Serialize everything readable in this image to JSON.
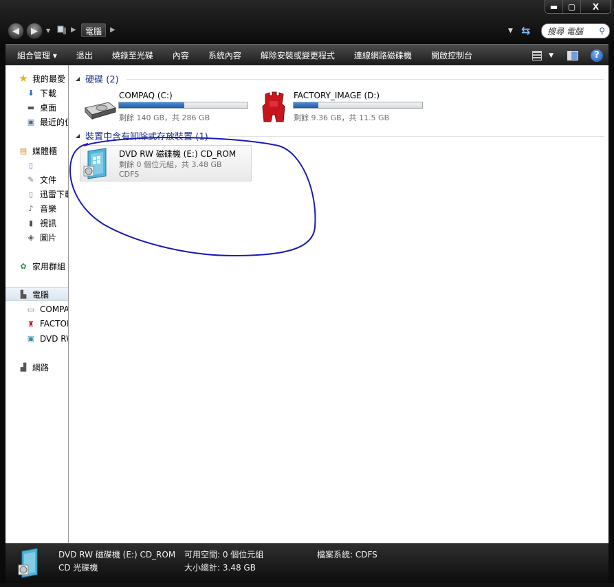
{
  "window": {
    "minimize": "▬",
    "maximize": "▢",
    "close": "X"
  },
  "address": {
    "crumb": "電腦"
  },
  "search": {
    "placeholder": "搜尋 電腦"
  },
  "toolbar": {
    "items": [
      "組合管理 ▾",
      "退出",
      "燒錄至光碟",
      "內容",
      "系統內容",
      "解除安裝或變更程式",
      "連線網路磁碟機",
      "開啟控制台"
    ]
  },
  "nav": {
    "favorites": "我的最愛",
    "downloads": "下載",
    "desktop": "桌面",
    "recent": "最近的位置",
    "libraries": "媒體櫃",
    "docs": "文件",
    "thunder": "迅雷下載",
    "music": "音樂",
    "video": "視訊",
    "pictures": "圖片",
    "homegroup": "家用群組",
    "computer": "電腦",
    "compaq": "COMPAQ (C:)",
    "factory": "FACTORY_IMAGE (D:)",
    "dvd": "DVD RW 磁碟機 (E:) CD_ROM",
    "network": "網路"
  },
  "groups": {
    "hdd": "硬碟 (2)",
    "removable": "裝置中含有卸除式存放裝置 (1)"
  },
  "drives": {
    "c": {
      "name": "COMPAQ (C:)",
      "free": "剩餘 140 GB，共 286 GB",
      "used_fraction": 0.51
    },
    "d": {
      "name": "FACTORY_IMAGE (D:)",
      "free": "剩餘 9.36 GB，共 11.5 GB",
      "used_fraction": 0.19
    },
    "e": {
      "name": "DVD RW 磁碟機 (E:) CD_ROM",
      "free": "剩餘 0 個位元組，共 3.48 GB",
      "fs": "CDFS"
    }
  },
  "status": {
    "name": "DVD RW 磁碟機 (E:) CD_ROM",
    "type": "CD 光碟機",
    "free_label": "可用空間: 0 個位元組",
    "total_label": "大小總計: 3.48 GB",
    "fs_label": "檔案系統: CDFS"
  },
  "colors": {
    "annotation": "#1a1ab8",
    "accent": "#1e3287",
    "bar": "#2a68b8"
  }
}
